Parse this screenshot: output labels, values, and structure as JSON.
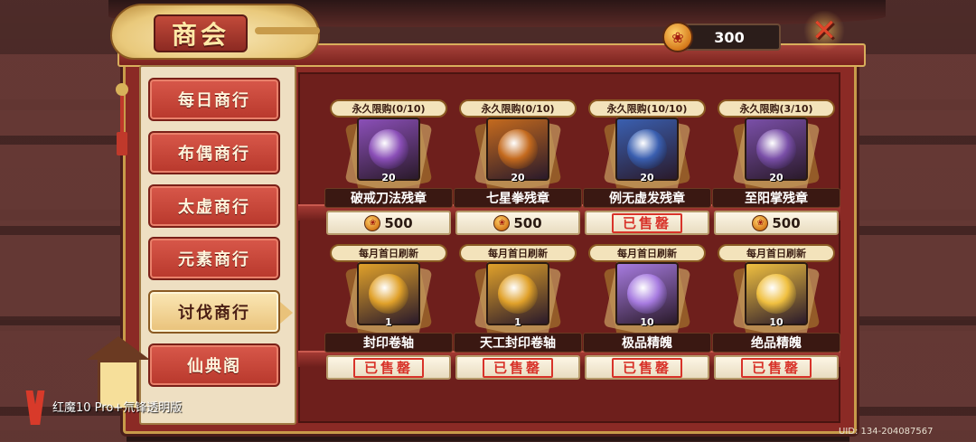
{
  "title": "商会",
  "currency": {
    "value": "300",
    "icon": "coin-icon"
  },
  "close_icon": "close-x-icon",
  "sidebar": {
    "items": [
      {
        "label": "每日商行",
        "active": false
      },
      {
        "label": "布偶商行",
        "active": false
      },
      {
        "label": "太虚商行",
        "active": false
      },
      {
        "label": "元素商行",
        "active": false
      },
      {
        "label": "讨伐商行",
        "active": true
      },
      {
        "label": "仙典阁",
        "active": false
      }
    ]
  },
  "items": [
    {
      "tag": "永久限购(0/10)",
      "count": "20",
      "name": "破戒刀法残章",
      "price": "500",
      "sold": false,
      "icon": "blade-card-icon",
      "color": "#8b4fb8"
    },
    {
      "tag": "永久限购(0/10)",
      "count": "20",
      "name": "七星拳残章",
      "price": "500",
      "sold": false,
      "icon": "fist-card-icon",
      "color": "#c46a1e"
    },
    {
      "tag": "永久限购(10/10)",
      "count": "20",
      "name": "例无虚发残章",
      "price": "",
      "sold": true,
      "icon": "beast-card-icon",
      "color": "#3a5fb0"
    },
    {
      "tag": "永久限购(3/10)",
      "count": "20",
      "name": "至阳掌残章",
      "price": "500",
      "sold": false,
      "icon": "palm-card-icon",
      "color": "#7a4fa8"
    },
    {
      "tag": "每月首日刷新",
      "count": "1",
      "name": "封印卷轴",
      "price": "",
      "sold": true,
      "icon": "scroll-icon",
      "color": "#e0a12a"
    },
    {
      "tag": "每月首日刷新",
      "count": "1",
      "name": "天工封印卷轴",
      "price": "",
      "sold": true,
      "icon": "craft-scroll-icon",
      "color": "#e0a12a"
    },
    {
      "tag": "每月首日刷新",
      "count": "10",
      "name": "极品精魄",
      "price": "",
      "sold": true,
      "icon": "purple-spirit-icon",
      "color": "#a77be0"
    },
    {
      "tag": "每月首日刷新",
      "count": "10",
      "name": "绝品精魄",
      "price": "",
      "sold": true,
      "icon": "gold-spirit-icon",
      "color": "#f0c040"
    }
  ],
  "sold_label": "已售罄",
  "footer": {
    "brand": "红魔10 Pro+氘锋透明版",
    "uid": "UID: 134-204087567"
  }
}
